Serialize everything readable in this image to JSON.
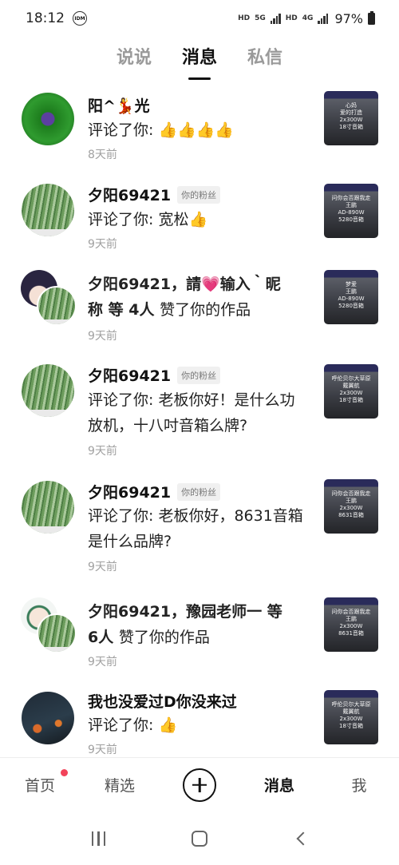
{
  "status_bar": {
    "time": "18:12",
    "idm": "IDM",
    "hd1": "HD",
    "net": "5G",
    "hd2": "HD",
    "net2": "4G",
    "battery": "97%"
  },
  "top_tabs": [
    {
      "label": "说说",
      "active": false
    },
    {
      "label": "消息",
      "active": true
    },
    {
      "label": "私信",
      "active": false
    }
  ],
  "items": [
    {
      "name": "阳^💃光",
      "badge": "",
      "text": "评论了你: 👍👍👍👍",
      "time": "8天前",
      "thumb": "心妈\n爱的打造\n2x300W\n18寸音箱"
    },
    {
      "name": "夕阳69421",
      "badge": "你的粉丝",
      "text": "评论了你: 宽松👍",
      "time": "9天前",
      "thumb": "问你会否跟我走\n王鹏\nAD-890W\n5280音箱"
    },
    {
      "name": "夕阳69421，請💗输入｀昵称 等 4人",
      "badge": "",
      "text": "赞了你的作品",
      "time": "9天前",
      "thumb": "梦爱\n王鹏\nAD-890W\n5280音箱"
    },
    {
      "name": "夕阳69421",
      "badge": "你的粉丝",
      "text": "评论了你: 老板你好！是什么功放机，十八吋音箱么牌?",
      "time": "9天前",
      "thumb": "呼伦贝尔大草原\n戴翼航\n2x300W\n18寸音箱"
    },
    {
      "name": "夕阳69421",
      "badge": "你的粉丝",
      "text": "评论了你: 老板你好，8631音箱是什么品牌?",
      "time": "9天前",
      "thumb": "问你会否跟我走\n王鹏\n2x300W\n8631音箱"
    },
    {
      "name": "夕阳69421，豫园老师一 等 6人",
      "badge": "",
      "text": "赞了你的作品",
      "time": "9天前",
      "thumb": "问你会否跟我走\n王鹏\n2x300W\n8631音箱"
    },
    {
      "name": "我也没爱过D你没来过",
      "badge": "",
      "text": "评论了你: 👍",
      "time": "9天前",
      "thumb": "呼伦贝尔大草原\n戴翼航\n2x300W\n18寸音箱"
    }
  ],
  "bottom_nav": {
    "home": "首页",
    "featured": "精选",
    "messages": "消息",
    "me": "我"
  }
}
